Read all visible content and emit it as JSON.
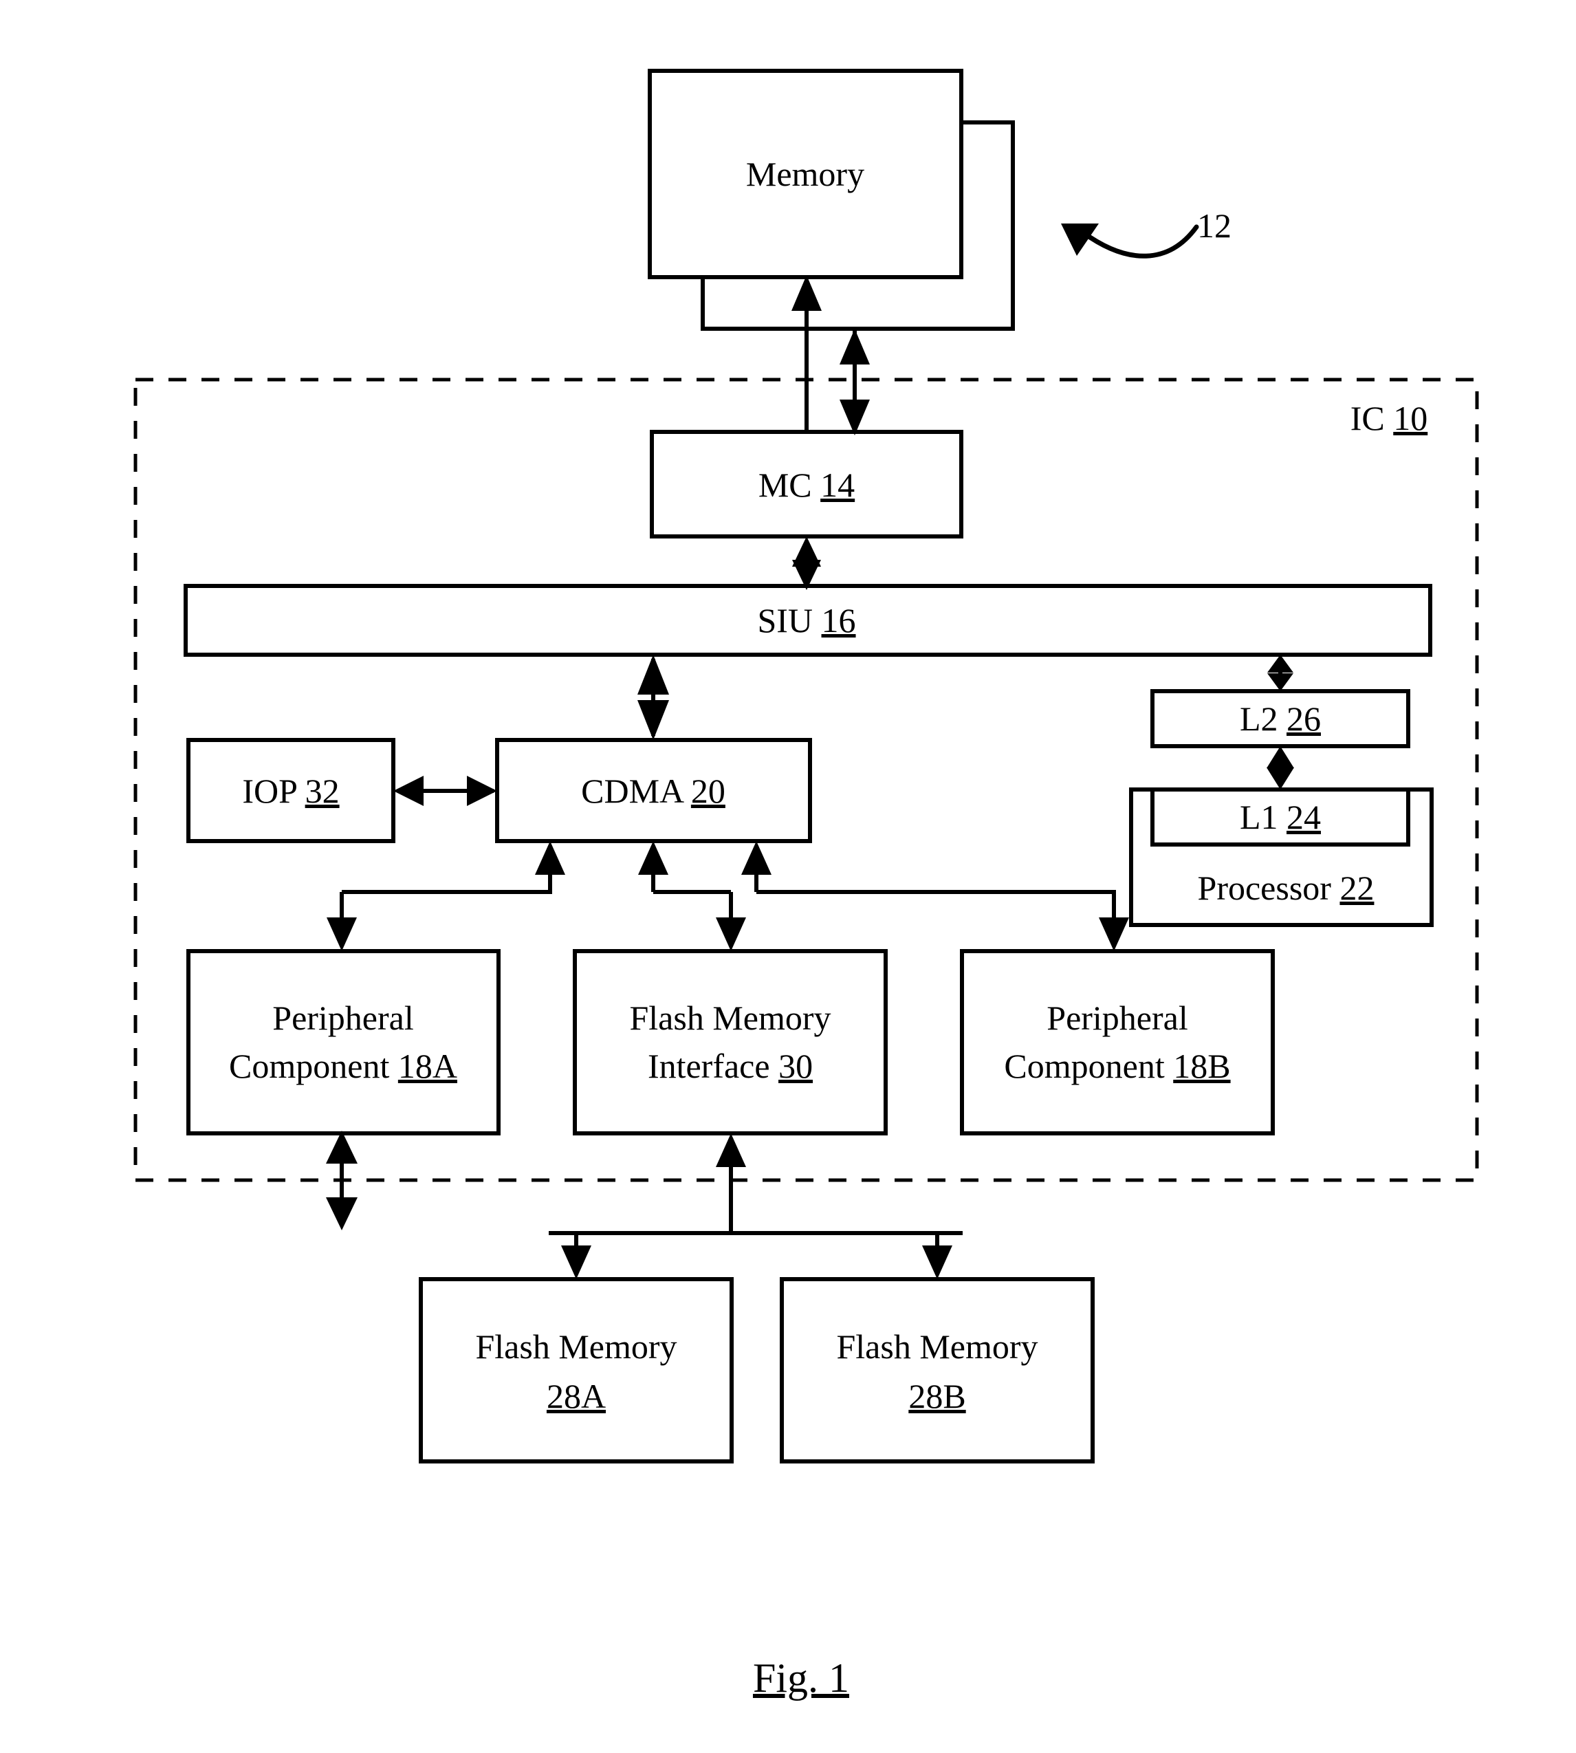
{
  "figure": {
    "caption": "Fig. 1",
    "reference_numeral_system": "12",
    "ic_boundary_label_prefix": "IC",
    "ic_boundary_label_number": "10"
  },
  "blocks": {
    "memory": {
      "label": "Memory",
      "numeral": ""
    },
    "mc": {
      "label": "MC",
      "numeral": "14"
    },
    "siu": {
      "label": "SIU",
      "numeral": "16"
    },
    "iop": {
      "label": "IOP",
      "numeral": "32"
    },
    "cdma": {
      "label": "CDMA",
      "numeral": "20"
    },
    "l2": {
      "label": "L2",
      "numeral": "26"
    },
    "l1": {
      "label": "L1",
      "numeral": "24"
    },
    "processor": {
      "label": "Processor",
      "numeral": "22"
    },
    "peripheral_a": {
      "line1": "Peripheral",
      "line2": "Component",
      "numeral": "18A"
    },
    "flash_interface": {
      "line1": "Flash Memory",
      "line2": "Interface",
      "numeral": "30"
    },
    "peripheral_b": {
      "line1": "Peripheral",
      "line2": "Component",
      "numeral": "18B"
    },
    "flash_memory_a": {
      "line1": "Flash Memory",
      "numeral": "28A"
    },
    "flash_memory_b": {
      "line1": "Flash Memory",
      "numeral": "28B"
    }
  },
  "colors": {
    "stroke": "#000000",
    "fill": "#ffffff"
  }
}
